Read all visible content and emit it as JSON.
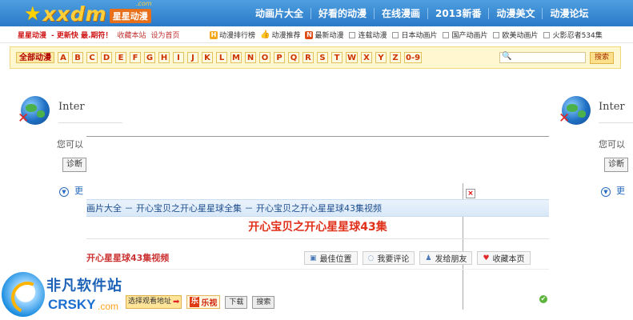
{
  "header": {
    "logo_text": "xxdm",
    "logo_com": ".com",
    "logo_sub": "星星动漫",
    "nav": [
      "动画片大全",
      "好看的动漫",
      "在线漫画",
      "2013新番",
      "动漫美文",
      "动漫论坛"
    ]
  },
  "subbar": {
    "left": [
      {
        "text": "星星动漫",
        "style": "red"
      },
      {
        "text": "- 更新快 最.期符！",
        "style": "red"
      },
      {
        "text": "收藏本站",
        "style": "plain"
      },
      {
        "text": "设为首页",
        "style": "plain"
      }
    ],
    "right": [
      {
        "badge": "H",
        "text": "动漫排行榜"
      },
      {
        "badge": "👍",
        "text": "动漫推荐"
      },
      {
        "badge": "N",
        "text": "最新动漫"
      },
      {
        "badge": "□",
        "text": "连载动漫"
      },
      {
        "badge": "□",
        "text": "日本动画片"
      },
      {
        "badge": "□",
        "text": "国产动画片"
      },
      {
        "badge": "□",
        "text": "欧美动画片"
      },
      {
        "badge": "□",
        "text": "火影忍者534集"
      }
    ]
  },
  "letterbar": {
    "all": "全部动漫",
    "letters": [
      "A",
      "B",
      "C",
      "D",
      "E",
      "F",
      "G",
      "H",
      "I",
      "J",
      "K",
      "L",
      "M",
      "N",
      "O",
      "P",
      "Q",
      "R",
      "S",
      "T",
      "W",
      "X",
      "Y",
      "Z",
      "0-9"
    ],
    "search_button": "搜索"
  },
  "error_left": {
    "title": "Inter",
    "text": "您可以",
    "diag": "诊断",
    "more": "更"
  },
  "error_right": {
    "title": "Inter",
    "text": "您可以",
    "diag": "诊断",
    "more": "更"
  },
  "overlay": {
    "close": "×",
    "breadcrumb": "画片大全 － 开心宝贝之开心星星球全集 － 开心宝贝之开心星星球43集视频",
    "video_title": "开心宝贝之开心星星球43集",
    "subtitle": "开心星星球43集视频",
    "actions": [
      {
        "icon": "monitor-icon",
        "glyph": "▣",
        "label": "最佳位置"
      },
      {
        "icon": "comment-icon",
        "glyph": "◌",
        "label": "我要评论"
      },
      {
        "icon": "user-icon",
        "glyph": "♟",
        "label": "发给朋友"
      },
      {
        "icon": "heart-icon",
        "glyph": "♥",
        "label": "收藏本页"
      }
    ]
  },
  "bottom": {
    "select_addr": "选择观看地址",
    "lv_mark": "乐",
    "lv_text": "乐视",
    "download": "下载",
    "search": "搜索"
  },
  "watermark": {
    "cn": "非凡软件站",
    "en": "CRSKY",
    "com": ".com"
  }
}
